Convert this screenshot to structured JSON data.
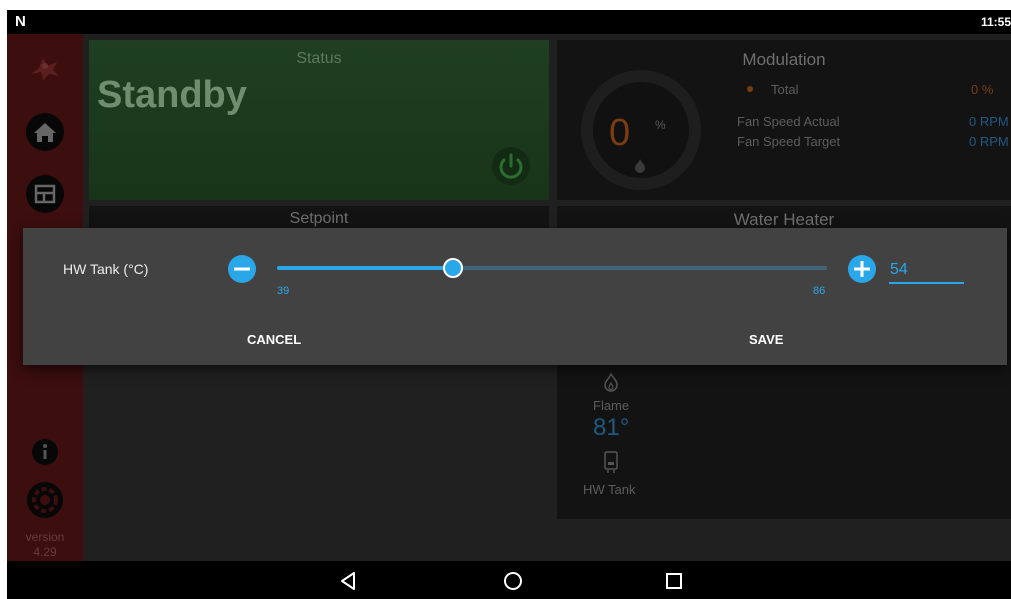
{
  "status_bar": {
    "logo": "N",
    "time": "11:55"
  },
  "sidebar": {
    "items": [
      {
        "name": "logo-icon"
      },
      {
        "name": "home-icon"
      },
      {
        "name": "dashboard-icon"
      },
      {
        "name": "info-icon"
      },
      {
        "name": "settings-icon"
      }
    ],
    "version_label": "version",
    "version_number": "4.29"
  },
  "status_card": {
    "title": "Status",
    "state": "Standby"
  },
  "modulation": {
    "title": "Modulation",
    "gauge_value": "0",
    "gauge_unit": "%",
    "total_label": "Total",
    "total_value": "0 %",
    "fan_actual_label": "Fan Speed Actual",
    "fan_actual_value": "0 RPM",
    "fan_target_label": "Fan Speed Target",
    "fan_target_value": "0 RPM"
  },
  "setpoint": {
    "title": "Setpoint"
  },
  "water_heater": {
    "title": "Water Heater",
    "flame_label": "Flame",
    "temperature": "81°",
    "tank_label": "HW Tank"
  },
  "dialog": {
    "label": "HW Tank (°C)",
    "min": 39,
    "max": 86,
    "value": 54,
    "min_label": "39",
    "max_label": "86",
    "input_value": "54",
    "cancel_label": "CANCEL",
    "save_label": "SAVE"
  },
  "nav": {
    "back": "back-icon",
    "home": "home-circle-icon",
    "recents": "recents-icon"
  },
  "colors": {
    "accent": "#2aa7e8",
    "status_green": "#1f3f22",
    "sidebar_red": "#3c0e0e",
    "modulation_orange": "#7a3d10"
  }
}
